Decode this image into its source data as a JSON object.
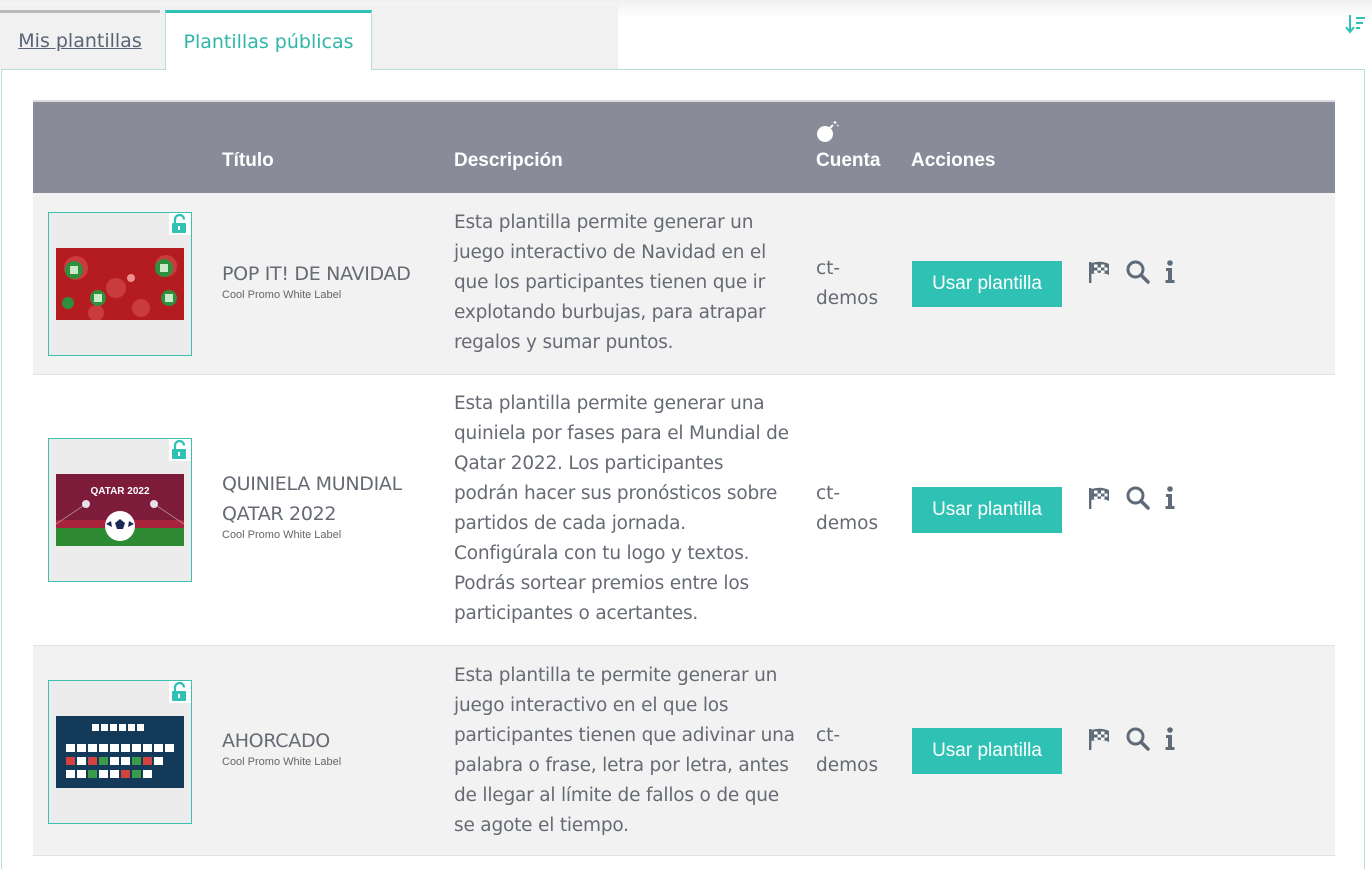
{
  "tabs": [
    {
      "label": "Mis plantillas",
      "active": false
    },
    {
      "label": "Plantillas públicas",
      "active": true
    }
  ],
  "header": {
    "thumbnail": "",
    "title": "Título",
    "description": "Descripción",
    "account_icon": "bomb-icon",
    "account": "Cuenta",
    "actions": "Acciones"
  },
  "rows": [
    {
      "title": "POP IT! DE NAVIDAD",
      "subtitle": "Cool Promo White Label",
      "description_lines": [
        "Esta plantilla permite generar un",
        "juego interactivo de Navidad en el",
        "que los participantes tienen que ir",
        "explotando burbujas, para atrapar",
        "regalos y sumar puntos."
      ],
      "account_lines": [
        "ct-",
        "demos"
      ],
      "button": "Usar plantilla"
    },
    {
      "title_lines": [
        "QUINIELA MUNDIAL",
        "QATAR 2022"
      ],
      "subtitle": "Cool Promo White Label",
      "thumb_text": "QATAR 2022",
      "description_lines": [
        "Esta plantilla permite generar una",
        "quiniela por fases para el Mundial de",
        "Qatar 2022. Los participantes",
        "podrán hacer sus pronósticos sobre",
        "partidos de cada jornada.",
        "Configúrala con tu logo y textos.",
        "Podrás sortear premios entre los",
        "participantes o acertantes."
      ],
      "account_lines": [
        "ct-",
        "demos"
      ],
      "button": "Usar plantilla"
    },
    {
      "title": "AHORCADO",
      "subtitle": "Cool Promo White Label",
      "description_lines": [
        "Esta plantilla te permite generar un",
        "juego interactivo en el que los",
        "participantes tienen que adivinar una",
        "palabra o frase, letra por letra, antes",
        "de llegar al límite de fallos o de que",
        "se agote el tiempo."
      ],
      "account_lines": [
        "ct-",
        "demos"
      ],
      "button": "Usar plantilla"
    }
  ],
  "icons": {
    "sort": "sort-icon",
    "lock": "unlock-icon",
    "flag": "checkered-flag-icon",
    "search": "search-icon",
    "info": "info-icon"
  },
  "colors": {
    "accent": "#2fc2b4",
    "header_bg": "#8a8b99",
    "icon_gray": "#5f6b78"
  }
}
